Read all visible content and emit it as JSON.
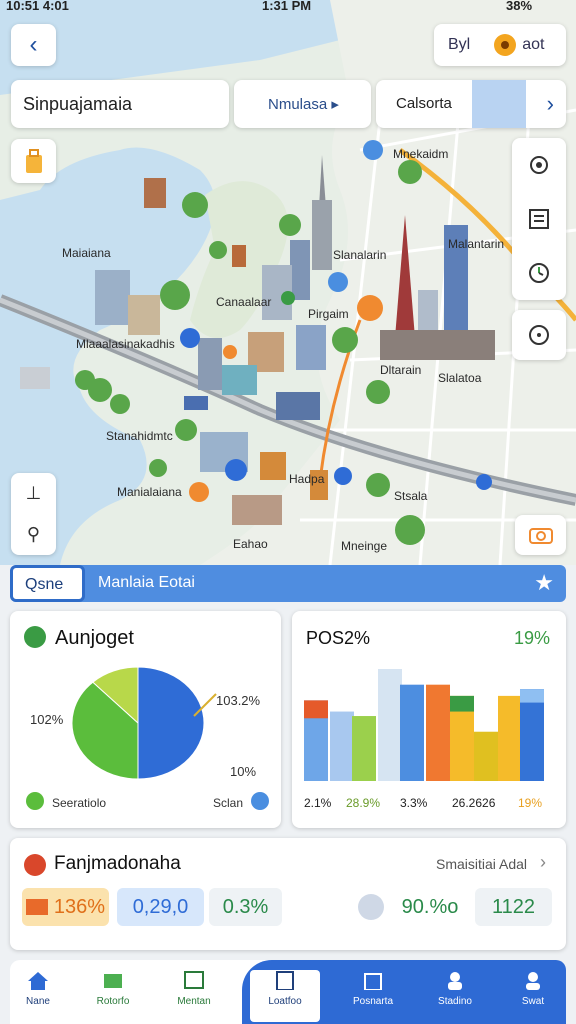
{
  "status_bar": {
    "left": "10:51 4:01",
    "time": "1:31 PM",
    "battery": "38%"
  },
  "header": {
    "right_label": "Byl",
    "right_label2": "aot"
  },
  "search": {
    "value": "Sinpuajamaia"
  },
  "simulate_button": {
    "label": "Nmulasa ▸"
  },
  "category": {
    "label": "Calsorta"
  },
  "map_labels": [
    "Mnekaidm",
    "Maiaiana",
    "Slanalarin",
    "Malantarin",
    "Canaalaar",
    "Pirgaim",
    "Mlaaalasinakadhis",
    "Dltarain",
    "Slalatoa",
    "Stanahidmtc",
    "Hadpa",
    "Manialaiana",
    "Stsala",
    "Eahao",
    "Mneinge"
  ],
  "info_bar": {
    "tab": "Qsne",
    "title": "Manlaia Eotai"
  },
  "pie_card": {
    "title": "Aunjoget",
    "left_pct": "102%",
    "right_pct": "103.2%",
    "bottom_pct": "10%",
    "legend_left": "Seeratiolo",
    "legend_right": "Sclan"
  },
  "bar_card": {
    "title": "POS2%",
    "pct": "19%",
    "x_labels": [
      "2.1%",
      "28.9%",
      "3.3%",
      "26.2626",
      "19%"
    ]
  },
  "bottom_card": {
    "title": "Fanjmadonaha",
    "link": "Smaisitiai Adal",
    "stats": [
      "136%",
      "0,29,0",
      "0.3%",
      "90.%o",
      "1122"
    ]
  },
  "nav": [
    "Nane",
    "Rotorfo",
    "Mentan",
    "Loatfoo",
    "Posnarta",
    "Stadino",
    "Swat"
  ],
  "chart_data": [
    {
      "type": "pie",
      "title": "Aunjoget",
      "slices": [
        {
          "value": 50,
          "color": "#2f6cd6"
        },
        {
          "value": 38,
          "color": "#5bbd3c"
        },
        {
          "value": 12,
          "color": "#b8d84a"
        }
      ],
      "annotations": [
        "102%",
        "103.2%",
        "10%"
      ]
    },
    {
      "type": "bar",
      "title": "POS2%",
      "ylim": [
        0,
        100
      ],
      "bars": [
        {
          "value": 72,
          "color": "#6ea6e8",
          "cap": 16,
          "cap_color": "#e55a2a"
        },
        {
          "value": 62,
          "color": "#a8c8ef"
        },
        {
          "value": 58,
          "color": "#9bd04c"
        },
        {
          "value": 100,
          "color": "#d6e4f2"
        },
        {
          "value": 86,
          "color": "#4d8ee0"
        },
        {
          "value": 86,
          "color": "#f07830"
        },
        {
          "value": 76,
          "color": "#f5bb2a",
          "cap": 14,
          "cap_color": "#3a9b44"
        },
        {
          "value": 44,
          "color": "#e0c020"
        },
        {
          "value": 76,
          "color": "#f5bb2a",
          "cap": 0
        },
        {
          "value": 82,
          "color": "#3473d6",
          "cap": 12,
          "cap_color": "#8fbff2"
        }
      ]
    }
  ]
}
